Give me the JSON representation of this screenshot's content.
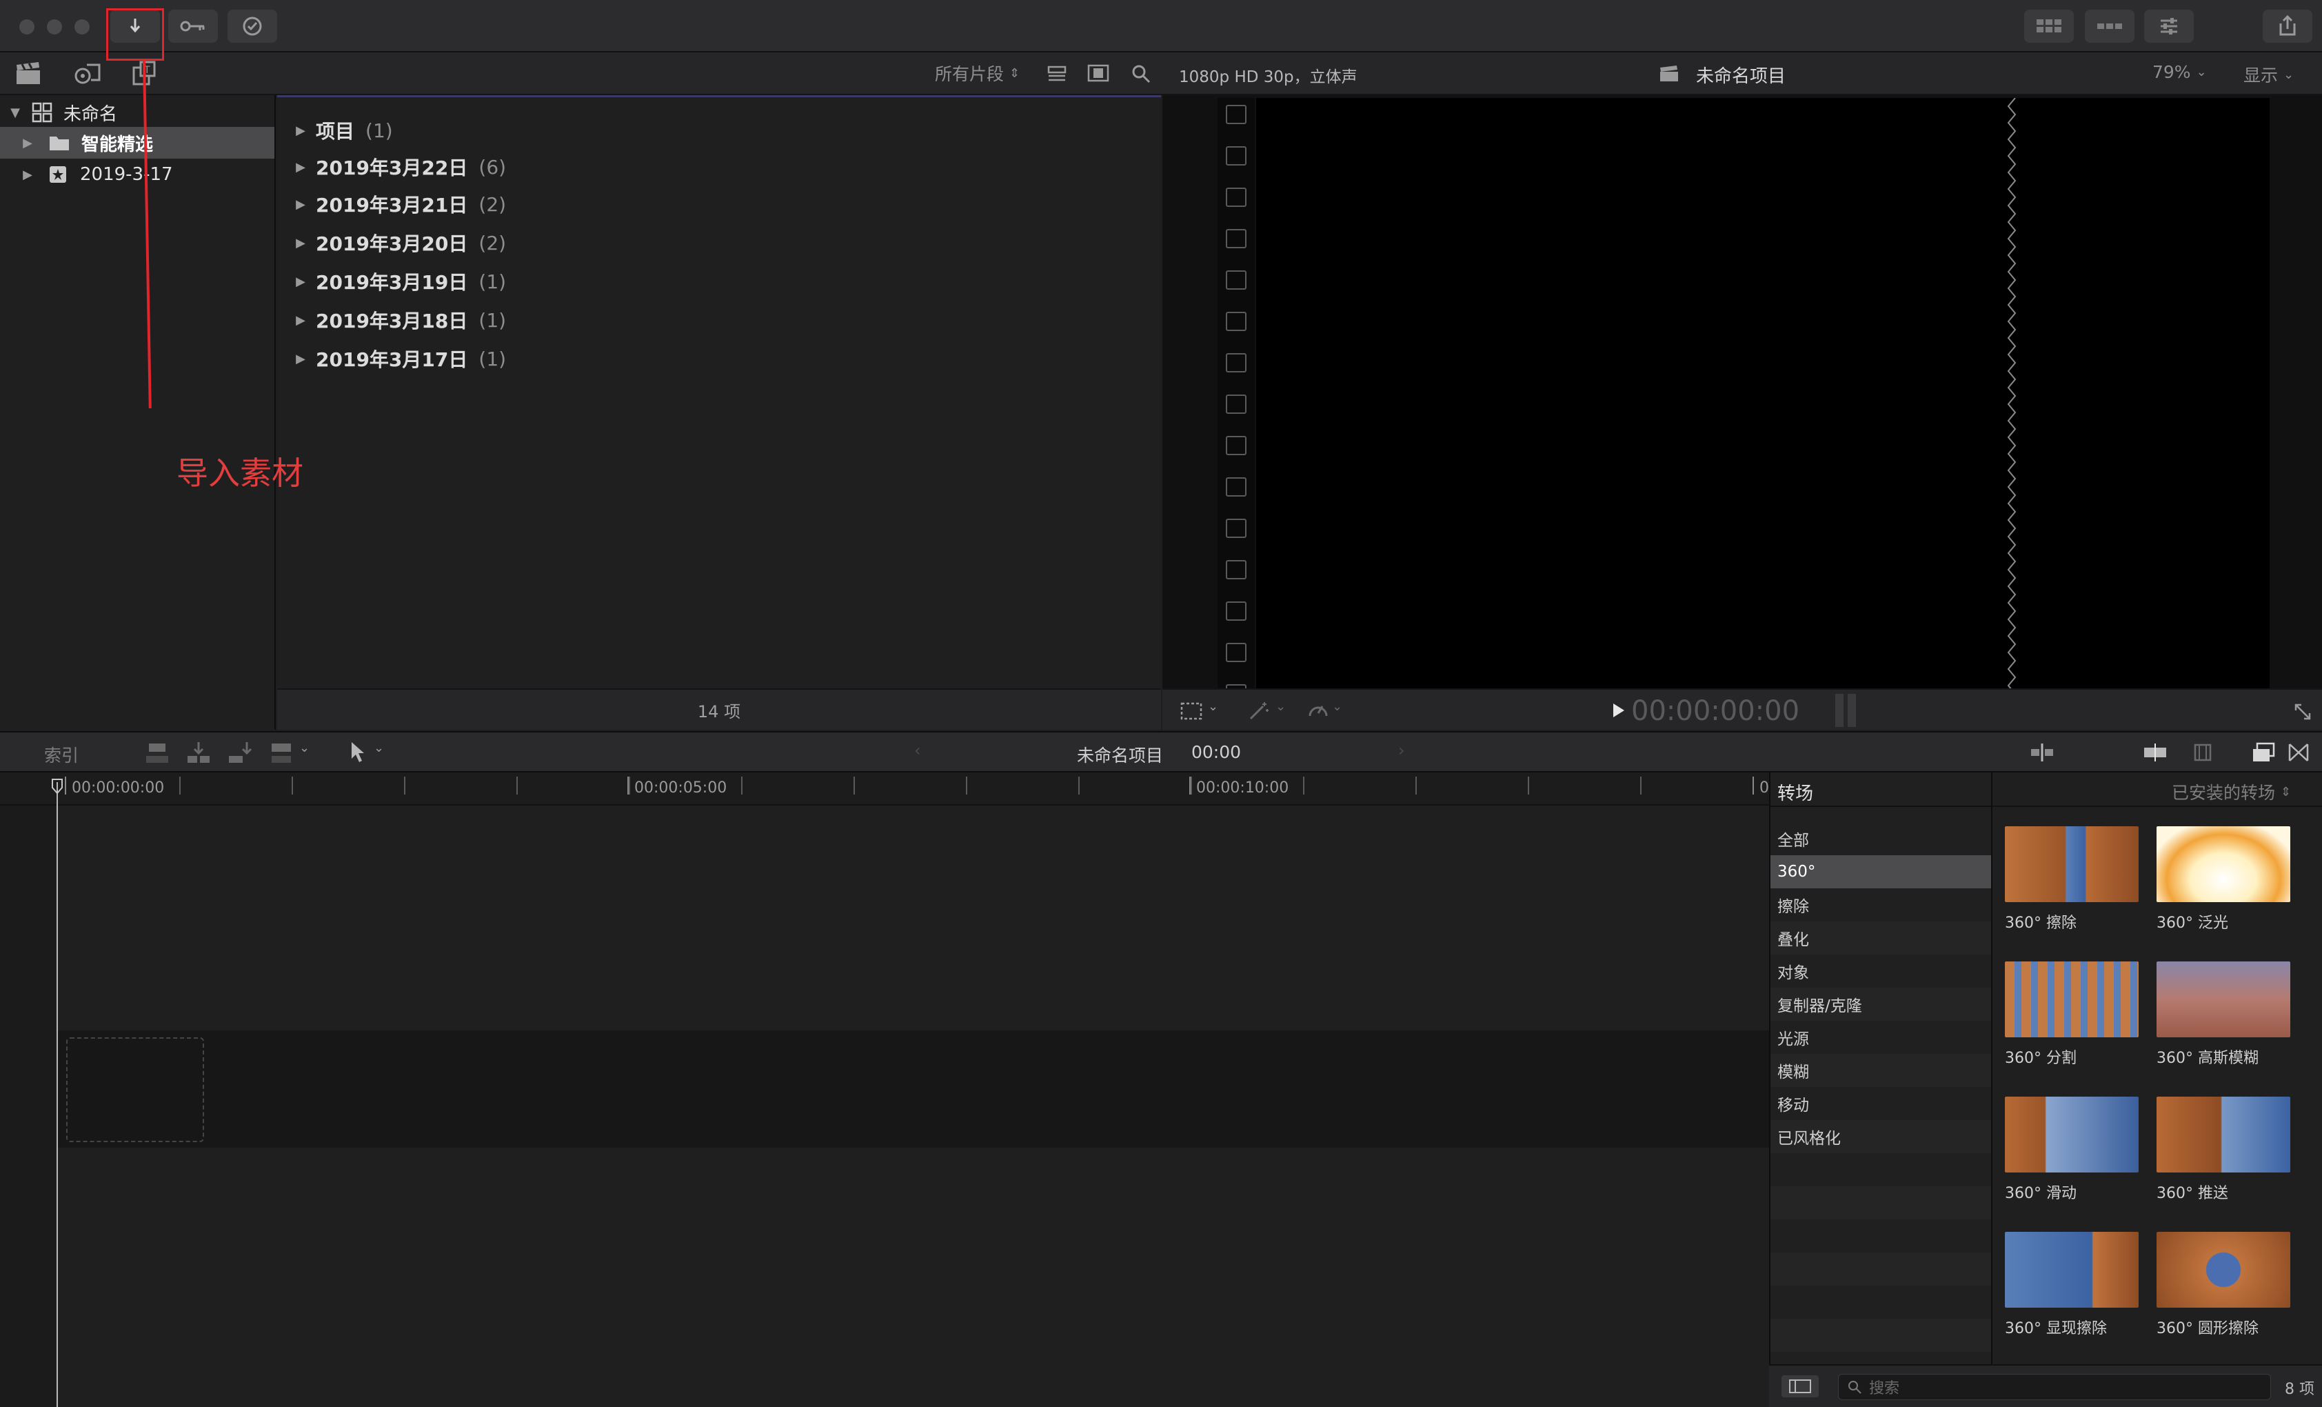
{
  "browser": {
    "filter_label": "所有片段",
    "library": {
      "name": "未命名"
    },
    "sidebar_items": [
      "智能精选",
      "2019-3-17"
    ],
    "events": [
      {
        "name": "项目",
        "count": "(1)"
      },
      {
        "name": "2019年3月22日",
        "count": "(6)"
      },
      {
        "name": "2019年3月21日",
        "count": "(2)"
      },
      {
        "name": "2019年3月20日",
        "count": "(2)"
      },
      {
        "name": "2019年3月19日",
        "count": "(1)"
      },
      {
        "name": "2019年3月18日",
        "count": "(1)"
      },
      {
        "name": "2019年3月17日",
        "count": "(1)"
      }
    ],
    "status": "14 项"
  },
  "viewer": {
    "format": "1080p HD 30p，立体声",
    "project_title": "未命名项目",
    "zoom": "79%",
    "display_label": "显示",
    "timecode": "00:00:00:00"
  },
  "timeline_toolbar": {
    "index_label": "索引",
    "project_name": "未命名项目",
    "duration": "00:00"
  },
  "ruler": {
    "labels": [
      "00:00:00:00",
      "00:00:05:00",
      "00:00:10:00",
      "0"
    ]
  },
  "transitions": {
    "title": "转场",
    "installed_label": "已安装的转场",
    "categories": [
      "全部",
      "360°",
      "擦除",
      "叠化",
      "对象",
      "复制器/克隆",
      "光源",
      "模糊",
      "移动",
      "已风格化"
    ],
    "selected_category": "360°",
    "items": [
      "360° 擦除",
      "360° 泛光",
      "360° 分割",
      "360° 高斯模糊",
      "360° 滑动",
      "360° 推送",
      "360° 显现擦除",
      "360° 圆形擦除"
    ],
    "search_placeholder": "搜索",
    "count": "8 项"
  },
  "annotation": {
    "text": "导入素材",
    "color": "#e0262a"
  }
}
